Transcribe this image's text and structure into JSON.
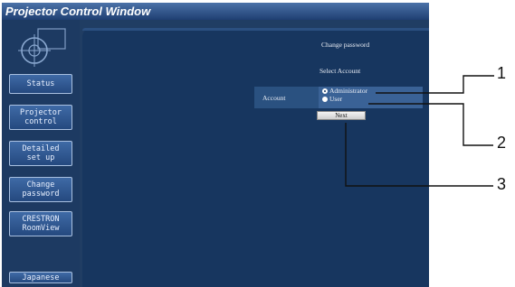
{
  "window": {
    "title": "Projector Control Window"
  },
  "sidebar": {
    "items": [
      {
        "label": "Status"
      },
      {
        "label": "Projector\ncontrol"
      },
      {
        "label": "Detailed\nset up"
      },
      {
        "label": "Change\npassword"
      },
      {
        "label": "CRESTRON\nRoomView"
      },
      {
        "label": "Japanese"
      }
    ]
  },
  "main": {
    "heading": "Change password",
    "subheading": "Select Account",
    "account_label": "Account",
    "options": [
      {
        "label": "Administrator",
        "selected": true
      },
      {
        "label": "User",
        "selected": false
      }
    ],
    "next_label": "Next"
  },
  "callouts": [
    "1",
    "2",
    "3"
  ],
  "colors": {
    "titlebar": "#2e5790",
    "frame": "#203d63",
    "content": "#17365f"
  }
}
